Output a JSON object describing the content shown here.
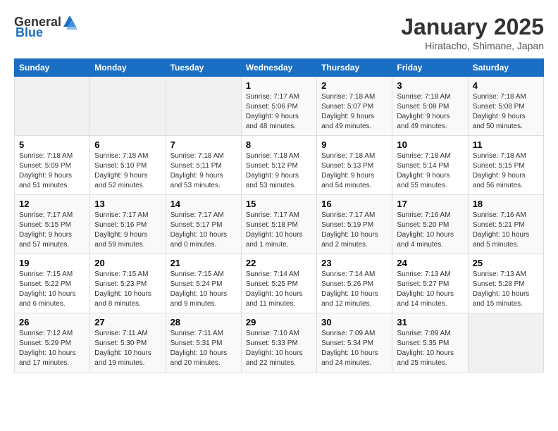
{
  "header": {
    "logo_general": "General",
    "logo_blue": "Blue",
    "month_title": "January 2025",
    "location": "Hiratacho, Shimane, Japan"
  },
  "days_of_week": [
    "Sunday",
    "Monday",
    "Tuesday",
    "Wednesday",
    "Thursday",
    "Friday",
    "Saturday"
  ],
  "weeks": [
    [
      {
        "day": "",
        "info": ""
      },
      {
        "day": "",
        "info": ""
      },
      {
        "day": "",
        "info": ""
      },
      {
        "day": "1",
        "info": "Sunrise: 7:17 AM\nSunset: 5:06 PM\nDaylight: 9 hours and 48 minutes."
      },
      {
        "day": "2",
        "info": "Sunrise: 7:18 AM\nSunset: 5:07 PM\nDaylight: 9 hours and 49 minutes."
      },
      {
        "day": "3",
        "info": "Sunrise: 7:18 AM\nSunset: 5:08 PM\nDaylight: 9 hours and 49 minutes."
      },
      {
        "day": "4",
        "info": "Sunrise: 7:18 AM\nSunset: 5:08 PM\nDaylight: 9 hours and 50 minutes."
      }
    ],
    [
      {
        "day": "5",
        "info": "Sunrise: 7:18 AM\nSunset: 5:09 PM\nDaylight: 9 hours and 51 minutes."
      },
      {
        "day": "6",
        "info": "Sunrise: 7:18 AM\nSunset: 5:10 PM\nDaylight: 9 hours and 52 minutes."
      },
      {
        "day": "7",
        "info": "Sunrise: 7:18 AM\nSunset: 5:11 PM\nDaylight: 9 hours and 53 minutes."
      },
      {
        "day": "8",
        "info": "Sunrise: 7:18 AM\nSunset: 5:12 PM\nDaylight: 9 hours and 53 minutes."
      },
      {
        "day": "9",
        "info": "Sunrise: 7:18 AM\nSunset: 5:13 PM\nDaylight: 9 hours and 54 minutes."
      },
      {
        "day": "10",
        "info": "Sunrise: 7:18 AM\nSunset: 5:14 PM\nDaylight: 9 hours and 55 minutes."
      },
      {
        "day": "11",
        "info": "Sunrise: 7:18 AM\nSunset: 5:15 PM\nDaylight: 9 hours and 56 minutes."
      }
    ],
    [
      {
        "day": "12",
        "info": "Sunrise: 7:17 AM\nSunset: 5:15 PM\nDaylight: 9 hours and 57 minutes."
      },
      {
        "day": "13",
        "info": "Sunrise: 7:17 AM\nSunset: 5:16 PM\nDaylight: 9 hours and 59 minutes."
      },
      {
        "day": "14",
        "info": "Sunrise: 7:17 AM\nSunset: 5:17 PM\nDaylight: 10 hours and 0 minutes."
      },
      {
        "day": "15",
        "info": "Sunrise: 7:17 AM\nSunset: 5:18 PM\nDaylight: 10 hours and 1 minute."
      },
      {
        "day": "16",
        "info": "Sunrise: 7:17 AM\nSunset: 5:19 PM\nDaylight: 10 hours and 2 minutes."
      },
      {
        "day": "17",
        "info": "Sunrise: 7:16 AM\nSunset: 5:20 PM\nDaylight: 10 hours and 4 minutes."
      },
      {
        "day": "18",
        "info": "Sunrise: 7:16 AM\nSunset: 5:21 PM\nDaylight: 10 hours and 5 minutes."
      }
    ],
    [
      {
        "day": "19",
        "info": "Sunrise: 7:15 AM\nSunset: 5:22 PM\nDaylight: 10 hours and 6 minutes."
      },
      {
        "day": "20",
        "info": "Sunrise: 7:15 AM\nSunset: 5:23 PM\nDaylight: 10 hours and 8 minutes."
      },
      {
        "day": "21",
        "info": "Sunrise: 7:15 AM\nSunset: 5:24 PM\nDaylight: 10 hours and 9 minutes."
      },
      {
        "day": "22",
        "info": "Sunrise: 7:14 AM\nSunset: 5:25 PM\nDaylight: 10 hours and 11 minutes."
      },
      {
        "day": "23",
        "info": "Sunrise: 7:14 AM\nSunset: 5:26 PM\nDaylight: 10 hours and 12 minutes."
      },
      {
        "day": "24",
        "info": "Sunrise: 7:13 AM\nSunset: 5:27 PM\nDaylight: 10 hours and 14 minutes."
      },
      {
        "day": "25",
        "info": "Sunrise: 7:13 AM\nSunset: 5:28 PM\nDaylight: 10 hours and 15 minutes."
      }
    ],
    [
      {
        "day": "26",
        "info": "Sunrise: 7:12 AM\nSunset: 5:29 PM\nDaylight: 10 hours and 17 minutes."
      },
      {
        "day": "27",
        "info": "Sunrise: 7:11 AM\nSunset: 5:30 PM\nDaylight: 10 hours and 19 minutes."
      },
      {
        "day": "28",
        "info": "Sunrise: 7:11 AM\nSunset: 5:31 PM\nDaylight: 10 hours and 20 minutes."
      },
      {
        "day": "29",
        "info": "Sunrise: 7:10 AM\nSunset: 5:33 PM\nDaylight: 10 hours and 22 minutes."
      },
      {
        "day": "30",
        "info": "Sunrise: 7:09 AM\nSunset: 5:34 PM\nDaylight: 10 hours and 24 minutes."
      },
      {
        "day": "31",
        "info": "Sunrise: 7:09 AM\nSunset: 5:35 PM\nDaylight: 10 hours and 25 minutes."
      },
      {
        "day": "",
        "info": ""
      }
    ]
  ]
}
